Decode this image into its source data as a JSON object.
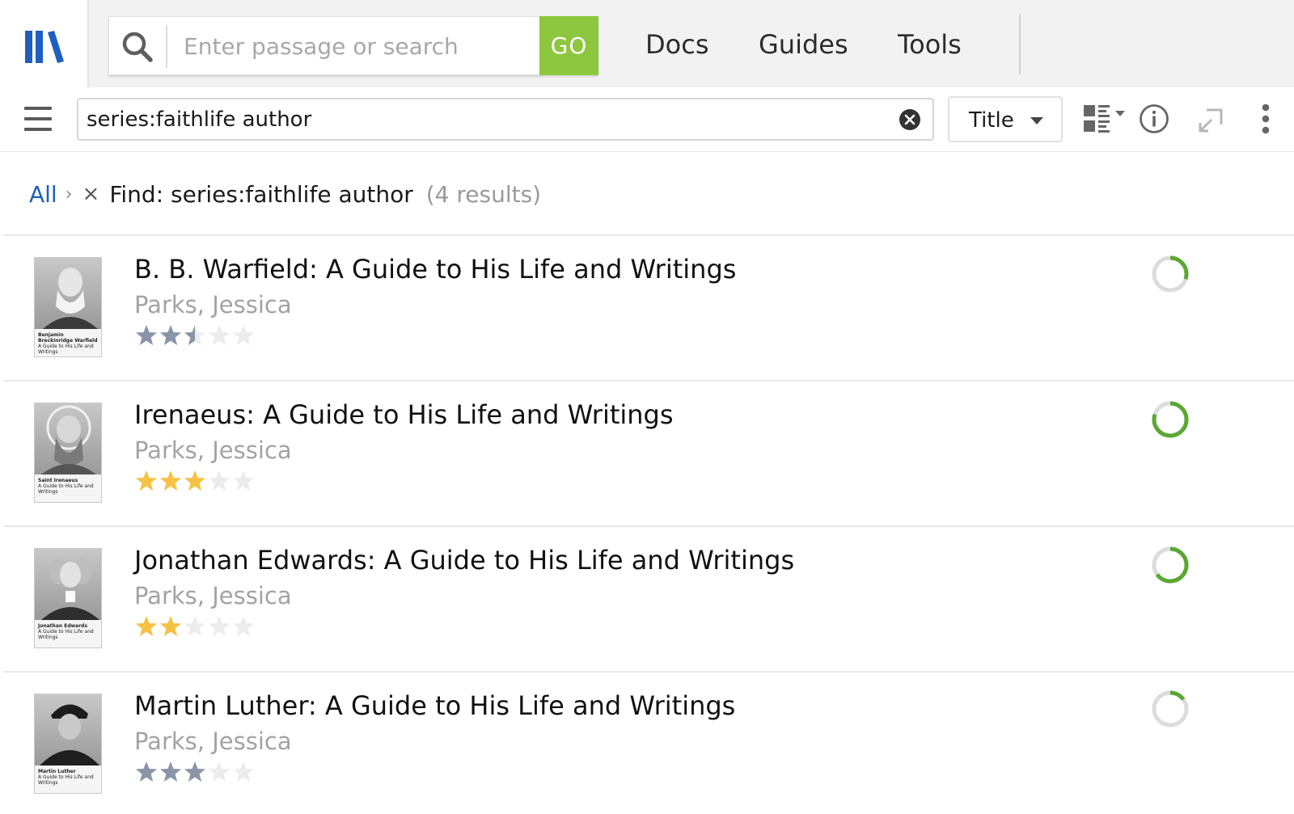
{
  "header": {
    "search": {
      "placeholder": "Enter passage or search",
      "go_label": "GO"
    },
    "nav": [
      {
        "label": "Docs"
      },
      {
        "label": "Guides"
      },
      {
        "label": "Tools"
      }
    ]
  },
  "toolbar": {
    "filter_value": "series:faithlife author",
    "sort_label": "Title"
  },
  "breadcrumb": {
    "root": "All",
    "separator": "›",
    "remove": "×",
    "query": "Find: series:faithlife author",
    "count": "(4 results)"
  },
  "results": [
    {
      "title": "B. B. Warfield: A Guide to His Life and Writings",
      "author": "Parks, Jessica",
      "cover_name": "Benjamin Breckinridge Warfield",
      "cover_subtitle": "A Guide to His Life and Writings",
      "rating": 2.5,
      "rating_color": "#8a96a8",
      "progress": 0.3,
      "progress_color": "#5aa832"
    },
    {
      "title": "Irenaeus: A Guide to His Life and Writings",
      "author": "Parks, Jessica",
      "cover_name": "Saint Irenaeus",
      "cover_subtitle": "A Guide to His Life and Writings",
      "rating": 3,
      "rating_color": "#f6c244",
      "progress": 0.8,
      "progress_color": "#5aa832"
    },
    {
      "title": "Jonathan Edwards: A Guide to His Life and Writings",
      "author": "Parks, Jessica",
      "cover_name": "Jonathan Edwards",
      "cover_subtitle": "A Guide to His Life and Writings",
      "rating": 2,
      "rating_color": "#f6c244",
      "progress": 0.65,
      "progress_color": "#5aa832"
    },
    {
      "title": "Martin Luther: A Guide to His Life and Writings",
      "author": "Parks, Jessica",
      "cover_name": "Martin Luther",
      "cover_subtitle": "A Guide to His Life and Writings",
      "rating": 3,
      "rating_color": "#8a96a8",
      "progress": 0.15,
      "progress_color": "#5aa832"
    }
  ],
  "colors": {
    "accent_go": "#8dc63f",
    "link_blue": "#1f5fbf",
    "logo_blue": "#1f5fbf"
  },
  "icons": {
    "logo": "library-logo-icon",
    "search": "search-icon",
    "menu": "hamburger-menu-icon",
    "clear": "clear-circle-x-icon",
    "view": "list-view-toggle-icon",
    "info": "info-circle-icon",
    "link": "sync-link-icon",
    "more": "more-vertical-icon"
  }
}
